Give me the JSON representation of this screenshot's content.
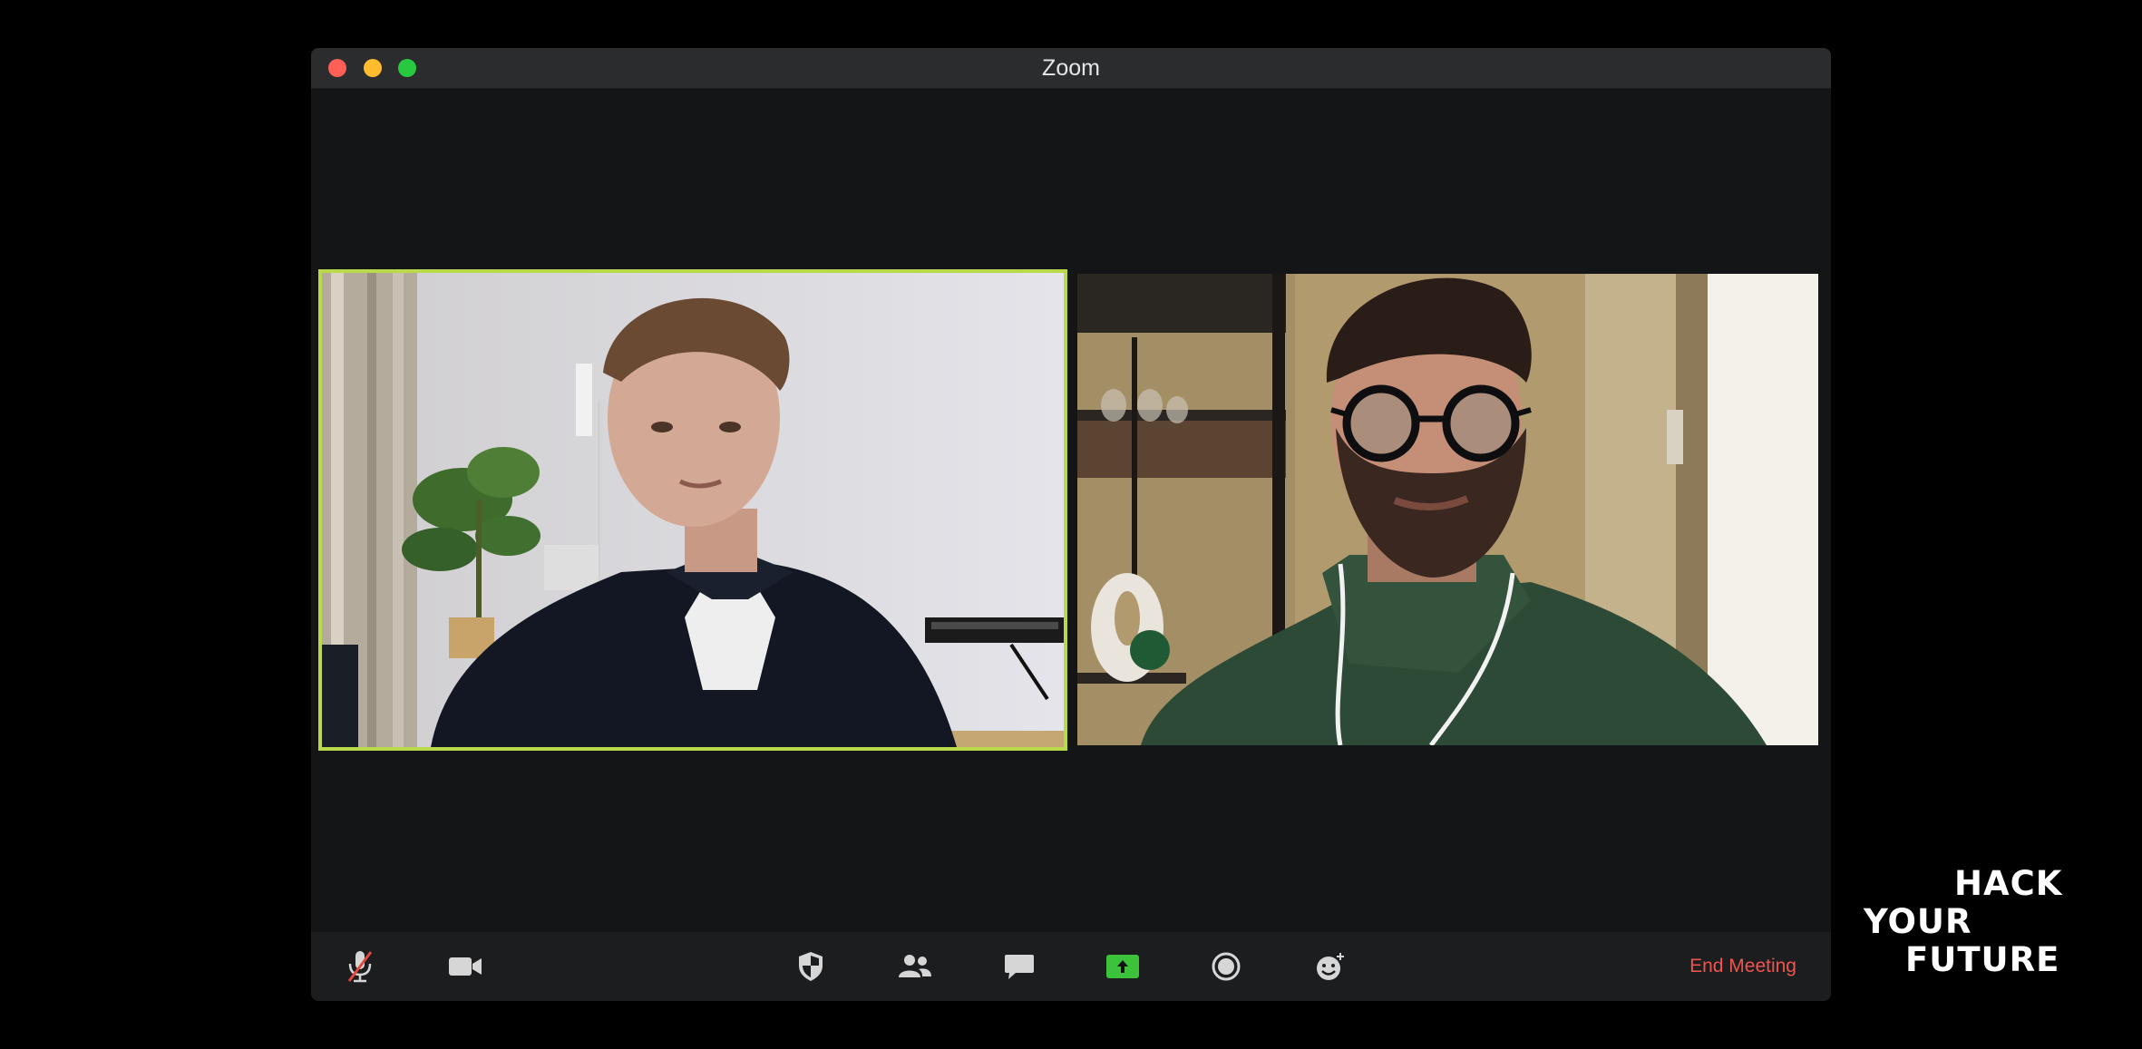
{
  "window": {
    "title": "Zoom"
  },
  "participants": [
    {
      "name": "left-participant",
      "active_speaker": true
    },
    {
      "name": "right-participant",
      "active_speaker": false
    }
  ],
  "toolbar": {
    "items": [
      {
        "name": "mute-button",
        "icon": "microphone-muted-icon"
      },
      {
        "name": "video-button",
        "icon": "video-camera-icon"
      },
      {
        "name": "security-button",
        "icon": "shield-icon"
      },
      {
        "name": "participants-button",
        "icon": "people-icon"
      },
      {
        "name": "chat-button",
        "icon": "chat-bubble-icon"
      },
      {
        "name": "share-screen-button",
        "icon": "share-arrow-icon"
      },
      {
        "name": "record-button",
        "icon": "record-icon"
      },
      {
        "name": "reactions-button",
        "icon": "emoji-icon"
      }
    ],
    "end_meeting_label": "End Meeting"
  },
  "colors": {
    "active_speaker_border": "#b9d94a",
    "share_green": "#3cc33b",
    "end_meeting_red": "#f0544f"
  },
  "logo": {
    "line1": "HACK",
    "line2": "YOUR",
    "line3": "FUTURE"
  }
}
